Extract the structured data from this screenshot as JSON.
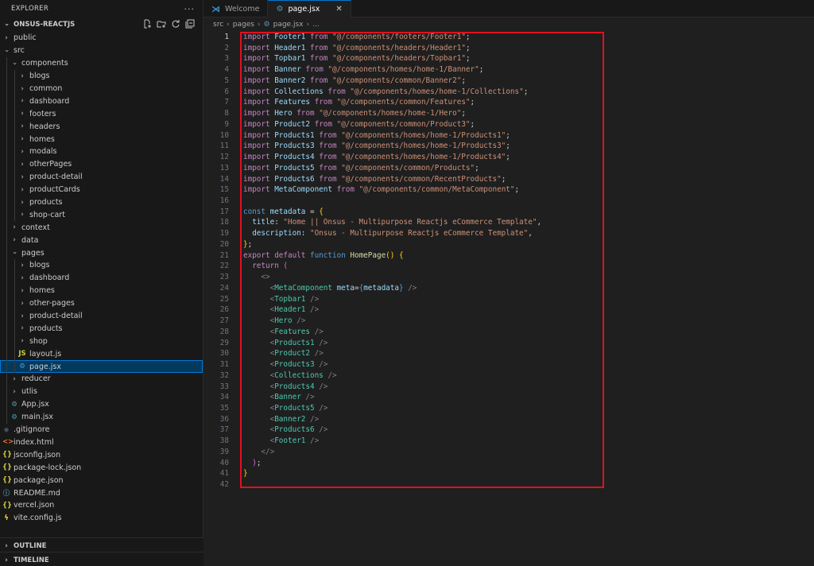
{
  "explorer": {
    "title": "EXPLORER",
    "more": "···",
    "project": "ONSUS-REACTJS"
  },
  "tree": [
    {
      "label": "public",
      "depth": 1,
      "kind": "folder",
      "open": false
    },
    {
      "label": "src",
      "depth": 1,
      "kind": "folder",
      "open": true
    },
    {
      "label": "components",
      "depth": 2,
      "kind": "folder",
      "open": true
    },
    {
      "label": "blogs",
      "depth": 3,
      "kind": "folder",
      "open": false
    },
    {
      "label": "common",
      "depth": 3,
      "kind": "folder",
      "open": false
    },
    {
      "label": "dashboard",
      "depth": 3,
      "kind": "folder",
      "open": false
    },
    {
      "label": "footers",
      "depth": 3,
      "kind": "folder",
      "open": false
    },
    {
      "label": "headers",
      "depth": 3,
      "kind": "folder",
      "open": false
    },
    {
      "label": "homes",
      "depth": 3,
      "kind": "folder",
      "open": false
    },
    {
      "label": "modals",
      "depth": 3,
      "kind": "folder",
      "open": false
    },
    {
      "label": "otherPages",
      "depth": 3,
      "kind": "folder",
      "open": false
    },
    {
      "label": "product-detail",
      "depth": 3,
      "kind": "folder",
      "open": false
    },
    {
      "label": "productCards",
      "depth": 3,
      "kind": "folder",
      "open": false
    },
    {
      "label": "products",
      "depth": 3,
      "kind": "folder",
      "open": false
    },
    {
      "label": "shop-cart",
      "depth": 3,
      "kind": "folder",
      "open": false
    },
    {
      "label": "context",
      "depth": 2,
      "kind": "folder",
      "open": false
    },
    {
      "label": "data",
      "depth": 2,
      "kind": "folder",
      "open": false
    },
    {
      "label": "pages",
      "depth": 2,
      "kind": "folder",
      "open": true
    },
    {
      "label": "blogs",
      "depth": 3,
      "kind": "folder",
      "open": false
    },
    {
      "label": "dashboard",
      "depth": 3,
      "kind": "folder",
      "open": false
    },
    {
      "label": "homes",
      "depth": 3,
      "kind": "folder",
      "open": false
    },
    {
      "label": "other-pages",
      "depth": 3,
      "kind": "folder",
      "open": false
    },
    {
      "label": "product-detail",
      "depth": 3,
      "kind": "folder",
      "open": false
    },
    {
      "label": "products",
      "depth": 3,
      "kind": "folder",
      "open": false
    },
    {
      "label": "shop",
      "depth": 3,
      "kind": "folder",
      "open": false
    },
    {
      "label": "layout.js",
      "depth": 3,
      "kind": "js"
    },
    {
      "label": "page.jsx",
      "depth": 3,
      "kind": "jsx",
      "selected": true
    },
    {
      "label": "reducer",
      "depth": 2,
      "kind": "folder",
      "open": false
    },
    {
      "label": "utlis",
      "depth": 2,
      "kind": "folder",
      "open": false
    },
    {
      "label": "App.jsx",
      "depth": 2,
      "kind": "jsx"
    },
    {
      "label": "main.jsx",
      "depth": 2,
      "kind": "jsx"
    },
    {
      "label": ".gitignore",
      "depth": 1,
      "kind": "git"
    },
    {
      "label": "index.html",
      "depth": 1,
      "kind": "html"
    },
    {
      "label": "jsconfig.json",
      "depth": 1,
      "kind": "json"
    },
    {
      "label": "package-lock.json",
      "depth": 1,
      "kind": "json"
    },
    {
      "label": "package.json",
      "depth": 1,
      "kind": "json"
    },
    {
      "label": "README.md",
      "depth": 1,
      "kind": "info"
    },
    {
      "label": "vercel.json",
      "depth": 1,
      "kind": "json"
    },
    {
      "label": "vite.config.js",
      "depth": 1,
      "kind": "vite"
    }
  ],
  "panels": {
    "outline": "OUTLINE",
    "timeline": "TIMELINE"
  },
  "tabs": [
    {
      "label": "Welcome",
      "active": false
    },
    {
      "label": "page.jsx",
      "active": true
    }
  ],
  "breadcrumb": {
    "parts": [
      "src",
      "pages",
      "page.jsx",
      "..."
    ]
  },
  "editor": {
    "current_line": 1,
    "lines": [
      [
        [
          "kw",
          "import"
        ],
        [
          "def",
          " "
        ],
        [
          "var",
          "Footer1"
        ],
        [
          "def",
          " "
        ],
        [
          "kw",
          "from"
        ],
        [
          "def",
          " "
        ],
        [
          "str",
          "\"@/components/footers/Footer1\""
        ],
        [
          "def",
          ";"
        ]
      ],
      [
        [
          "kw",
          "import"
        ],
        [
          "def",
          " "
        ],
        [
          "var",
          "Header1"
        ],
        [
          "def",
          " "
        ],
        [
          "kw",
          "from"
        ],
        [
          "def",
          " "
        ],
        [
          "str",
          "\"@/components/headers/Header1\""
        ],
        [
          "def",
          ";"
        ]
      ],
      [
        [
          "kw",
          "import"
        ],
        [
          "def",
          " "
        ],
        [
          "var",
          "Topbar1"
        ],
        [
          "def",
          " "
        ],
        [
          "kw",
          "from"
        ],
        [
          "def",
          " "
        ],
        [
          "str",
          "\"@/components/headers/Topbar1\""
        ],
        [
          "def",
          ";"
        ]
      ],
      [
        [
          "kw",
          "import"
        ],
        [
          "def",
          " "
        ],
        [
          "var",
          "Banner"
        ],
        [
          "def",
          " "
        ],
        [
          "kw",
          "from"
        ],
        [
          "def",
          " "
        ],
        [
          "str",
          "\"@/components/homes/home-1/Banner\""
        ],
        [
          "def",
          ";"
        ]
      ],
      [
        [
          "kw",
          "import"
        ],
        [
          "def",
          " "
        ],
        [
          "var",
          "Banner2"
        ],
        [
          "def",
          " "
        ],
        [
          "kw",
          "from"
        ],
        [
          "def",
          " "
        ],
        [
          "str",
          "\"@/components/common/Banner2\""
        ],
        [
          "def",
          ";"
        ]
      ],
      [
        [
          "kw",
          "import"
        ],
        [
          "def",
          " "
        ],
        [
          "var",
          "Collections"
        ],
        [
          "def",
          " "
        ],
        [
          "kw",
          "from"
        ],
        [
          "def",
          " "
        ],
        [
          "str",
          "\"@/components/homes/home-1/Collections\""
        ],
        [
          "def",
          ";"
        ]
      ],
      [
        [
          "kw",
          "import"
        ],
        [
          "def",
          " "
        ],
        [
          "var",
          "Features"
        ],
        [
          "def",
          " "
        ],
        [
          "kw",
          "from"
        ],
        [
          "def",
          " "
        ],
        [
          "str",
          "\"@/components/common/Features\""
        ],
        [
          "def",
          ";"
        ]
      ],
      [
        [
          "kw",
          "import"
        ],
        [
          "def",
          " "
        ],
        [
          "var",
          "Hero"
        ],
        [
          "def",
          " "
        ],
        [
          "kw",
          "from"
        ],
        [
          "def",
          " "
        ],
        [
          "str",
          "\"@/components/homes/home-1/Hero\""
        ],
        [
          "def",
          ";"
        ]
      ],
      [
        [
          "kw",
          "import"
        ],
        [
          "def",
          " "
        ],
        [
          "var",
          "Product2"
        ],
        [
          "def",
          " "
        ],
        [
          "kw",
          "from"
        ],
        [
          "def",
          " "
        ],
        [
          "str",
          "\"@/components/common/Product3\""
        ],
        [
          "def",
          ";"
        ]
      ],
      [
        [
          "kw",
          "import"
        ],
        [
          "def",
          " "
        ],
        [
          "var",
          "Products1"
        ],
        [
          "def",
          " "
        ],
        [
          "kw",
          "from"
        ],
        [
          "def",
          " "
        ],
        [
          "str",
          "\"@/components/homes/home-1/Products1\""
        ],
        [
          "def",
          ";"
        ]
      ],
      [
        [
          "kw",
          "import"
        ],
        [
          "def",
          " "
        ],
        [
          "var",
          "Products3"
        ],
        [
          "def",
          " "
        ],
        [
          "kw",
          "from"
        ],
        [
          "def",
          " "
        ],
        [
          "str",
          "\"@/components/homes/home-1/Products3\""
        ],
        [
          "def",
          ";"
        ]
      ],
      [
        [
          "kw",
          "import"
        ],
        [
          "def",
          " "
        ],
        [
          "var",
          "Products4"
        ],
        [
          "def",
          " "
        ],
        [
          "kw",
          "from"
        ],
        [
          "def",
          " "
        ],
        [
          "str",
          "\"@/components/homes/home-1/Products4\""
        ],
        [
          "def",
          ";"
        ]
      ],
      [
        [
          "kw",
          "import"
        ],
        [
          "def",
          " "
        ],
        [
          "var",
          "Products5"
        ],
        [
          "def",
          " "
        ],
        [
          "kw",
          "from"
        ],
        [
          "def",
          " "
        ],
        [
          "str",
          "\"@/components/common/Products\""
        ],
        [
          "def",
          ";"
        ]
      ],
      [
        [
          "kw",
          "import"
        ],
        [
          "def",
          " "
        ],
        [
          "var",
          "Products6"
        ],
        [
          "def",
          " "
        ],
        [
          "kw",
          "from"
        ],
        [
          "def",
          " "
        ],
        [
          "str",
          "\"@/components/common/RecentProducts\""
        ],
        [
          "def",
          ";"
        ]
      ],
      [
        [
          "kw",
          "import"
        ],
        [
          "def",
          " "
        ],
        [
          "var",
          "MetaComponent"
        ],
        [
          "def",
          " "
        ],
        [
          "kw",
          "from"
        ],
        [
          "def",
          " "
        ],
        [
          "str",
          "\"@/components/common/MetaComponent\""
        ],
        [
          "def",
          ";"
        ]
      ],
      [],
      [
        [
          "dec",
          "const"
        ],
        [
          "def",
          " "
        ],
        [
          "var",
          "metadata"
        ],
        [
          "def",
          " = "
        ],
        [
          "br",
          "{"
        ]
      ],
      [
        [
          "def",
          "  "
        ],
        [
          "var",
          "title"
        ],
        [
          "def",
          ": "
        ],
        [
          "str",
          "\"Home || Onsus - Multipurpose Reactjs eCommerce Template\""
        ],
        [
          "def",
          ","
        ]
      ],
      [
        [
          "def",
          "  "
        ],
        [
          "var",
          "description"
        ],
        [
          "def",
          ": "
        ],
        [
          "str",
          "\"Onsus - Multipurpose Reactjs eCommerce Template\""
        ],
        [
          "def",
          ","
        ]
      ],
      [
        [
          "br",
          "}"
        ],
        [
          "def",
          ";"
        ]
      ],
      [
        [
          "kw",
          "export"
        ],
        [
          "def",
          " "
        ],
        [
          "kw",
          "default"
        ],
        [
          "def",
          " "
        ],
        [
          "dec",
          "function"
        ],
        [
          "def",
          " "
        ],
        [
          "fn",
          "HomePage"
        ],
        [
          "br",
          "()"
        ],
        [
          "def",
          " "
        ],
        [
          "br",
          "{"
        ]
      ],
      [
        [
          "def",
          "  "
        ],
        [
          "kw",
          "return"
        ],
        [
          "def",
          " "
        ],
        [
          "br2",
          "("
        ]
      ],
      [
        [
          "def",
          "    "
        ],
        [
          "pun",
          "<>"
        ]
      ],
      [
        [
          "def",
          "      "
        ],
        [
          "pun",
          "<"
        ],
        [
          "tag",
          "MetaComponent"
        ],
        [
          "def",
          " "
        ],
        [
          "var",
          "meta"
        ],
        [
          "def",
          "="
        ],
        [
          "dec",
          "{"
        ],
        [
          "var",
          "metadata"
        ],
        [
          "dec",
          "}"
        ],
        [
          "def",
          " "
        ],
        [
          "pun",
          "/>"
        ]
      ],
      [
        [
          "def",
          "      "
        ],
        [
          "pun",
          "<"
        ],
        [
          "tag",
          "Topbar1"
        ],
        [
          "def",
          " "
        ],
        [
          "pun",
          "/>"
        ]
      ],
      [
        [
          "def",
          "      "
        ],
        [
          "pun",
          "<"
        ],
        [
          "tag",
          "Header1"
        ],
        [
          "def",
          " "
        ],
        [
          "pun",
          "/>"
        ]
      ],
      [
        [
          "def",
          "      "
        ],
        [
          "pun",
          "<"
        ],
        [
          "tag",
          "Hero"
        ],
        [
          "def",
          " "
        ],
        [
          "pun",
          "/>"
        ]
      ],
      [
        [
          "def",
          "      "
        ],
        [
          "pun",
          "<"
        ],
        [
          "tag",
          "Features"
        ],
        [
          "def",
          " "
        ],
        [
          "pun",
          "/>"
        ]
      ],
      [
        [
          "def",
          "      "
        ],
        [
          "pun",
          "<"
        ],
        [
          "tag",
          "Products1"
        ],
        [
          "def",
          " "
        ],
        [
          "pun",
          "/>"
        ]
      ],
      [
        [
          "def",
          "      "
        ],
        [
          "pun",
          "<"
        ],
        [
          "tag",
          "Product2"
        ],
        [
          "def",
          " "
        ],
        [
          "pun",
          "/>"
        ]
      ],
      [
        [
          "def",
          "      "
        ],
        [
          "pun",
          "<"
        ],
        [
          "tag",
          "Products3"
        ],
        [
          "def",
          " "
        ],
        [
          "pun",
          "/>"
        ]
      ],
      [
        [
          "def",
          "      "
        ],
        [
          "pun",
          "<"
        ],
        [
          "tag",
          "Collections"
        ],
        [
          "def",
          " "
        ],
        [
          "pun",
          "/>"
        ]
      ],
      [
        [
          "def",
          "      "
        ],
        [
          "pun",
          "<"
        ],
        [
          "tag",
          "Products4"
        ],
        [
          "def",
          " "
        ],
        [
          "pun",
          "/>"
        ]
      ],
      [
        [
          "def",
          "      "
        ],
        [
          "pun",
          "<"
        ],
        [
          "tag",
          "Banner"
        ],
        [
          "def",
          " "
        ],
        [
          "pun",
          "/>"
        ]
      ],
      [
        [
          "def",
          "      "
        ],
        [
          "pun",
          "<"
        ],
        [
          "tag",
          "Products5"
        ],
        [
          "def",
          " "
        ],
        [
          "pun",
          "/>"
        ]
      ],
      [
        [
          "def",
          "      "
        ],
        [
          "pun",
          "<"
        ],
        [
          "tag",
          "Banner2"
        ],
        [
          "def",
          " "
        ],
        [
          "pun",
          "/>"
        ]
      ],
      [
        [
          "def",
          "      "
        ],
        [
          "pun",
          "<"
        ],
        [
          "tag",
          "Products6"
        ],
        [
          "def",
          " "
        ],
        [
          "pun",
          "/>"
        ]
      ],
      [
        [
          "def",
          "      "
        ],
        [
          "pun",
          "<"
        ],
        [
          "tag",
          "Footer1"
        ],
        [
          "def",
          " "
        ],
        [
          "pun",
          "/>"
        ]
      ],
      [
        [
          "def",
          "    "
        ],
        [
          "pun",
          "</>"
        ]
      ],
      [
        [
          "def",
          "  "
        ],
        [
          "br2",
          ")"
        ],
        [
          "def",
          ";"
        ]
      ],
      [
        [
          "br",
          "}"
        ]
      ],
      []
    ]
  },
  "colors": {
    "highlight_border": "#e01020",
    "selection_bg": "#04395e",
    "accent": "#0078d4"
  },
  "icons": {
    "new-file": "new-file-icon",
    "new-folder": "new-folder-icon",
    "refresh": "refresh-icon",
    "collapse": "collapse-all-icon"
  }
}
